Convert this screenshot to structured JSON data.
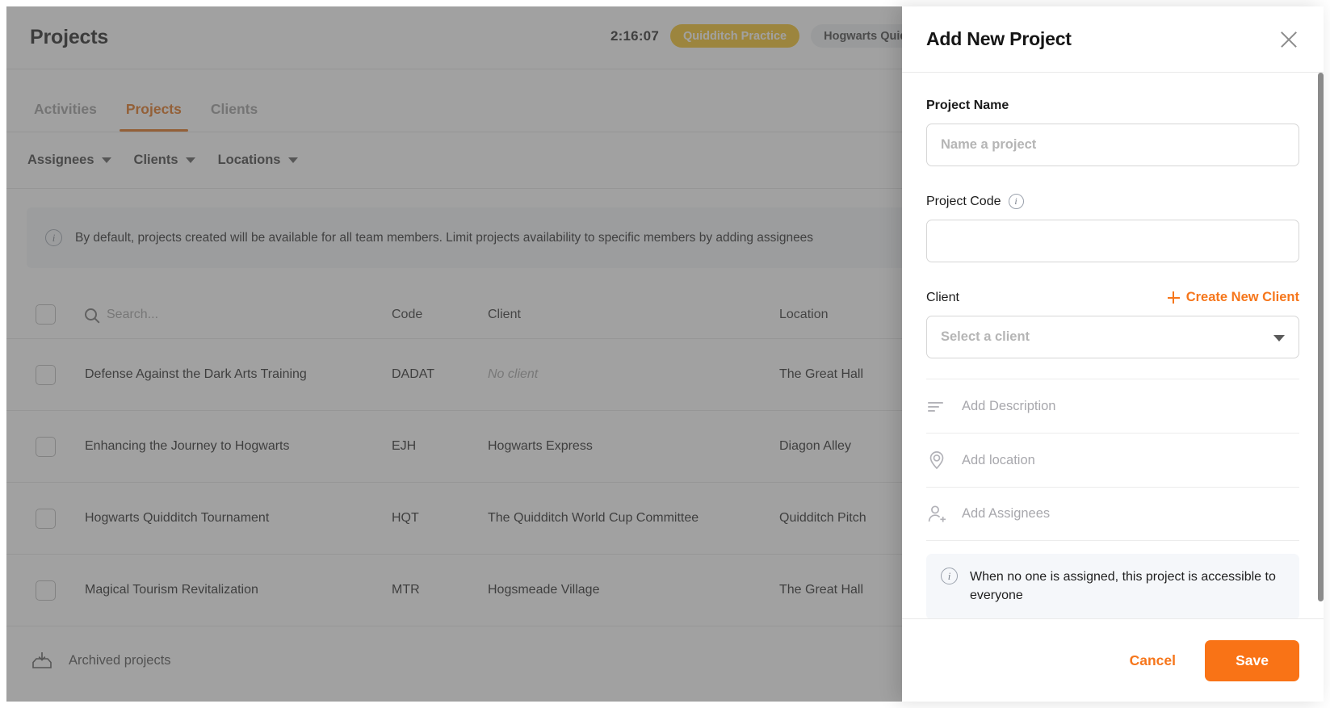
{
  "app": {
    "header": {
      "page_title": "Projects",
      "timer": "2:16:07",
      "active_task_chip": "Quidditch Practice",
      "project_chip": "Hogwarts Quidd"
    },
    "tabs": [
      {
        "label": "Activities",
        "active": false
      },
      {
        "label": "Projects",
        "active": true
      },
      {
        "label": "Clients",
        "active": false
      }
    ],
    "filters": [
      {
        "label": "Assignees"
      },
      {
        "label": "Clients"
      },
      {
        "label": "Locations"
      }
    ],
    "notice": {
      "icon": "info-icon",
      "text": "By default, projects created will be available for all team members. Limit projects availability to specific members by adding assignees"
    },
    "table": {
      "search_placeholder": "Search...",
      "columns": [
        "Code",
        "Client",
        "Location"
      ],
      "rows": [
        {
          "name": "Defense Against the Dark Arts Training",
          "code": "DADAT",
          "client": "No client",
          "client_empty": true,
          "location": "The Great Hall"
        },
        {
          "name": "Enhancing the Journey to Hogwarts",
          "code": "EJH",
          "client": "Hogwarts Express",
          "client_empty": false,
          "location": "Diagon Alley"
        },
        {
          "name": "Hogwarts Quidditch Tournament",
          "code": "HQT",
          "client": "The Quidditch World Cup Committee",
          "client_empty": false,
          "location": "Quidditch Pitch"
        },
        {
          "name": "Magical Tourism Revitalization",
          "code": "MTR",
          "client": "Hogsmeade Village",
          "client_empty": false,
          "location": "The Great Hall"
        }
      ]
    },
    "archived": {
      "label": "Archived projects",
      "icon": "archive-download-icon"
    }
  },
  "panel": {
    "title": "Add New Project",
    "close_icon": "close-icon",
    "project_name": {
      "label": "Project Name",
      "value": "",
      "placeholder": "Name a project"
    },
    "project_code": {
      "label": "Project Code",
      "info_icon": "info-icon",
      "value": "",
      "placeholder": ""
    },
    "client": {
      "label": "Client",
      "create_new_label": "Create New Client",
      "create_new_icon": "plus-icon",
      "selected": "Select a client",
      "caret_icon": "chevron-down-icon"
    },
    "extra_rows": [
      {
        "label": "Add Description",
        "icon": "description-lines-icon"
      },
      {
        "label": "Add location",
        "icon": "map-pin-icon"
      },
      {
        "label": "Add Assignees",
        "icon": "person-add-icon"
      }
    ],
    "assignee_note": {
      "icon": "info-icon",
      "text": "When no one is assigned, this project is accessible to everyone"
    },
    "footer": {
      "cancel_label": "Cancel",
      "save_label": "Save"
    }
  },
  "colors": {
    "accent_orange": "#F97316",
    "tab_active": "#E06C12",
    "chip_amber": "#F4C01E",
    "link_orange": "#F6761B"
  }
}
